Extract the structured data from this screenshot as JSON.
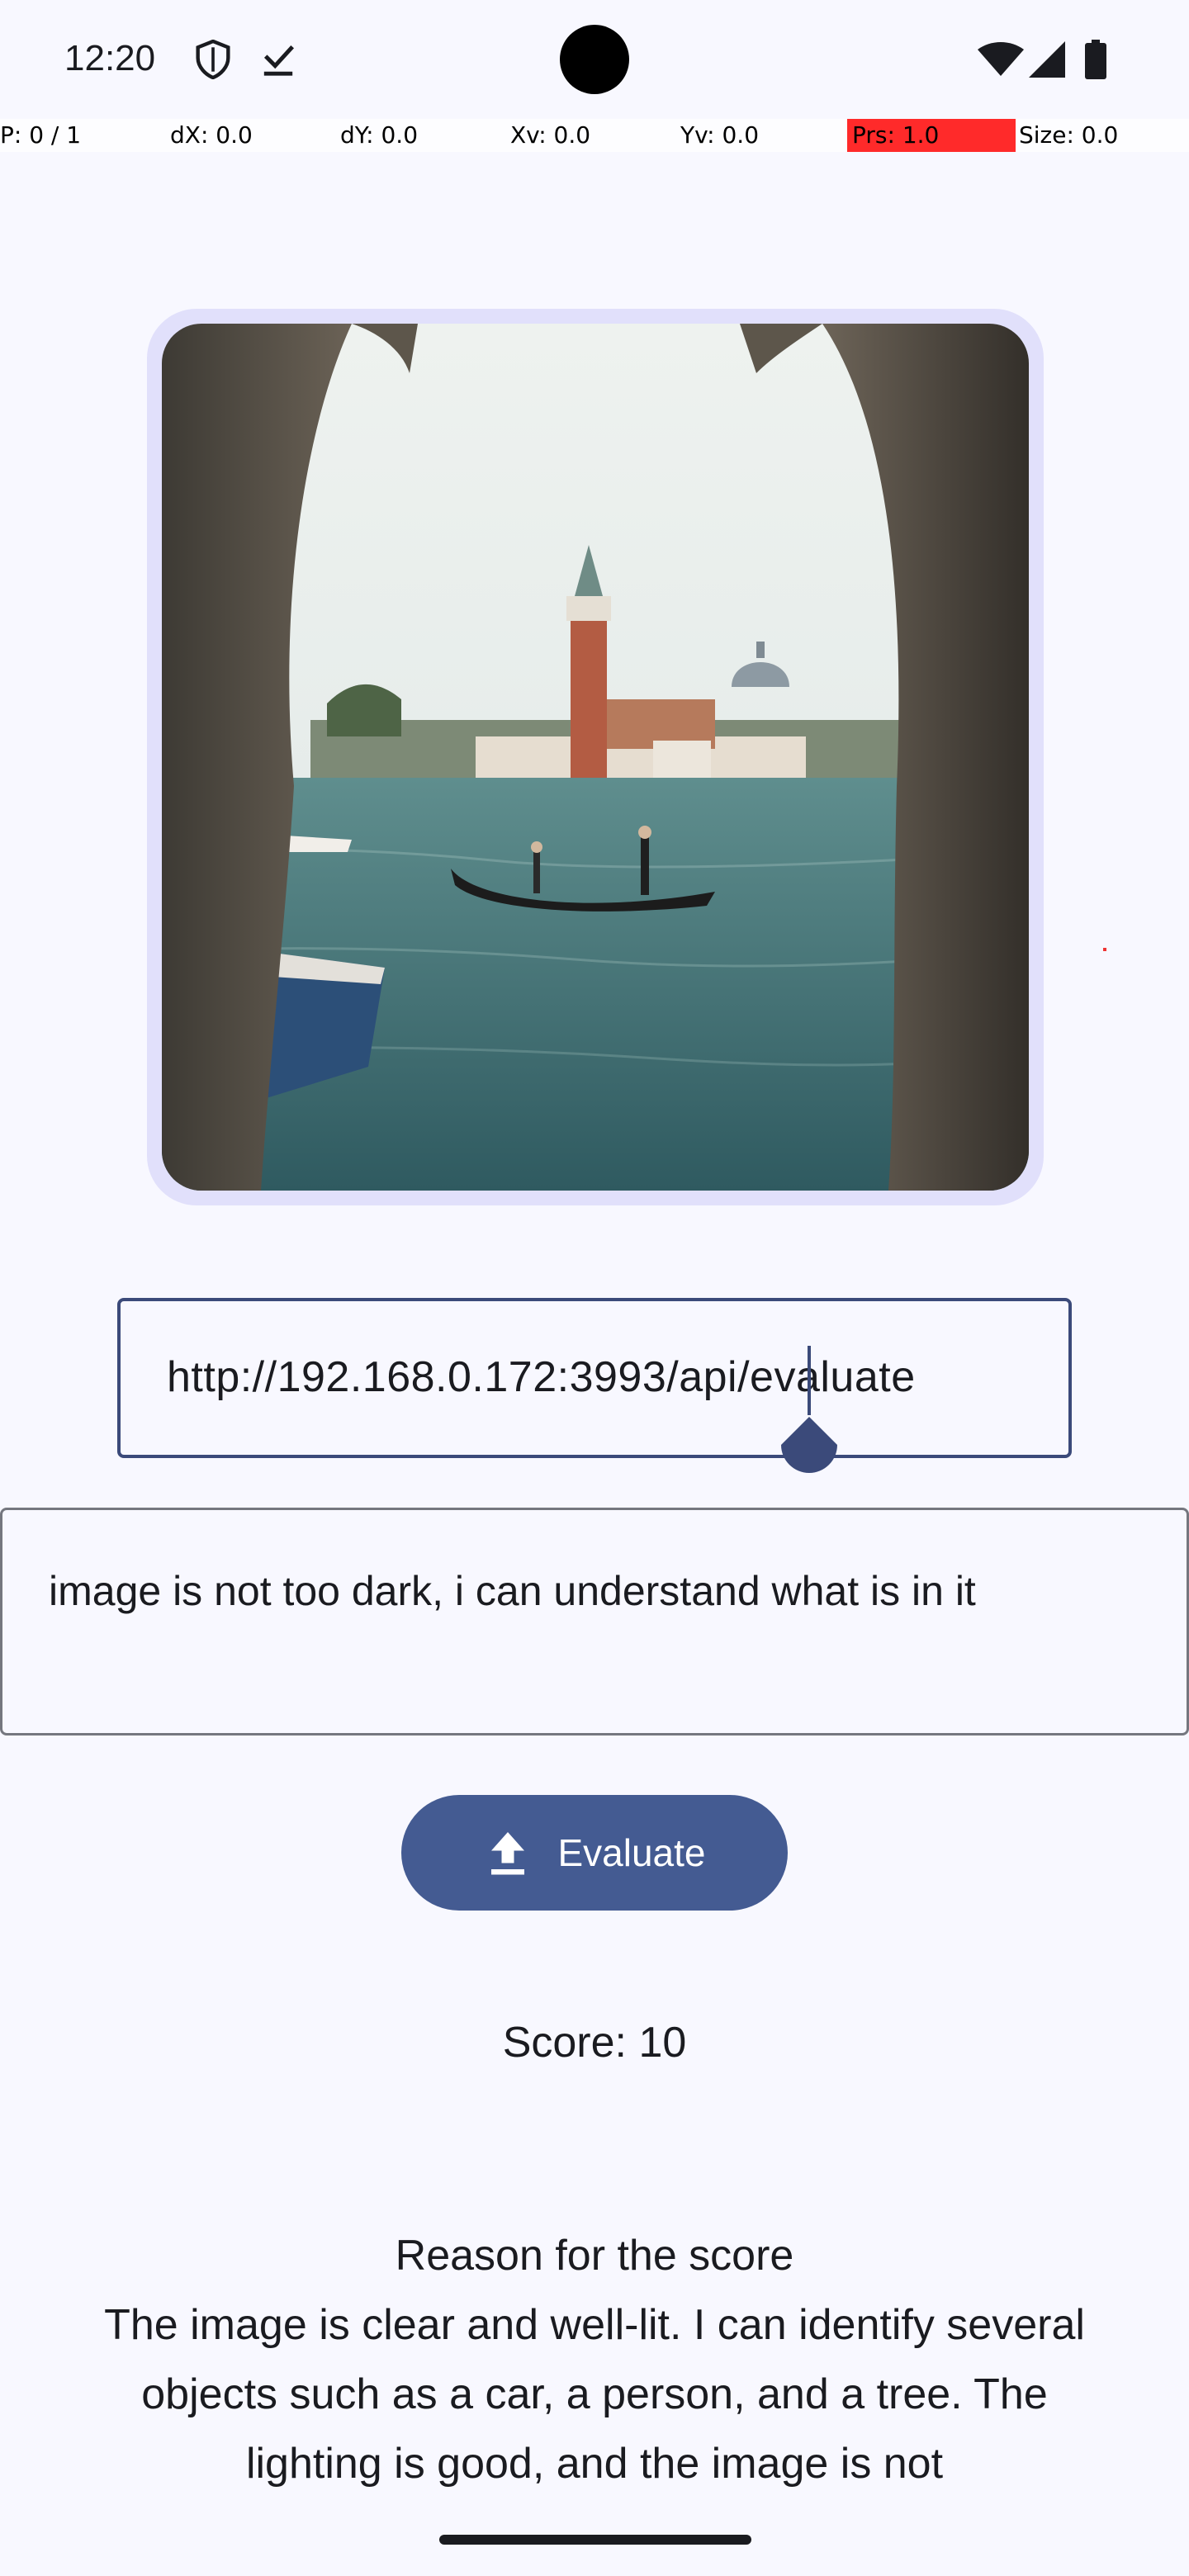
{
  "status_bar": {
    "time": "12:20",
    "icons": [
      "shield-icon",
      "download-done-icon",
      "wifi-icon",
      "signal-icon",
      "battery-icon"
    ]
  },
  "pointer_overlay": {
    "p": "P: 0 / 1",
    "dx": "dX: 0.0",
    "dy": "dY: 0.0",
    "xv": "Xv: 0.0",
    "yv": "Yv: 0.0",
    "prs": "Prs: 1.0",
    "size": "Size: 0.0"
  },
  "image_preview": {
    "subject": "gondola-canal-photo"
  },
  "url_input": {
    "value": "http://192.168.0.172:3993/api/evaluate"
  },
  "prompt_input": {
    "value": "image is not too dark, i can understand what is in it"
  },
  "evaluate_button": {
    "label": "Evaluate",
    "icon": "upload-icon"
  },
  "result": {
    "score": "Score: 10",
    "reason_title": "Reason for the score",
    "reason_text": "The image is clear and well-lit. I can identify several objects such as a car, a person, and a tree. The lighting is good, and the image is not"
  },
  "colors": {
    "background": "#f8f8ff",
    "accent": "#445b92",
    "frame": "#e1e0fb",
    "outline": "#3b4a7a"
  }
}
